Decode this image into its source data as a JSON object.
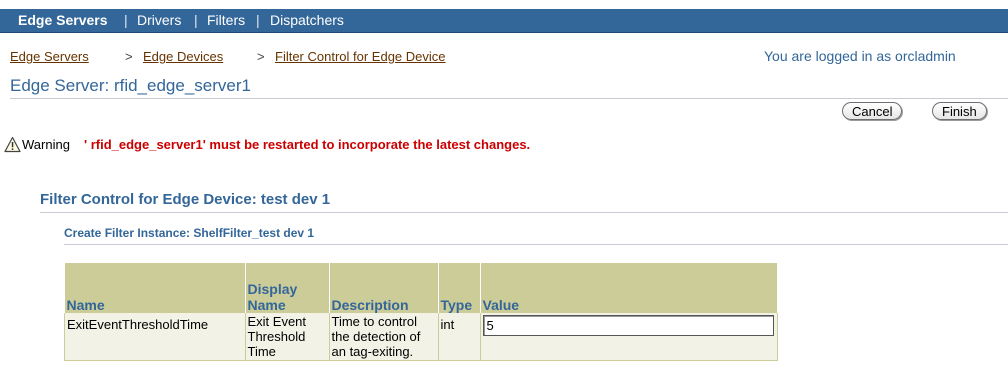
{
  "topnav": {
    "items": [
      "Edge Servers",
      "Drivers",
      "Filters",
      "Dispatchers"
    ],
    "separator": "|"
  },
  "breadcrumb": {
    "items": [
      "Edge Servers",
      "Edge Devices",
      "Filter Control for Edge Device"
    ],
    "separator": ">"
  },
  "user": {
    "logged_in_text": "You are logged in as orcladmin"
  },
  "page": {
    "title": "Edge Server: rfid_edge_server1"
  },
  "buttons": {
    "cancel": "Cancel",
    "finish": "Finish"
  },
  "warning": {
    "label": "Warning",
    "message": "' rfid_edge_server1' must be restarted to incorporate the latest changes."
  },
  "section": {
    "title": "Filter Control for Edge Device: test dev 1",
    "subtitle": "Create Filter Instance: ShelfFilter_test dev 1"
  },
  "table": {
    "headers": [
      "Name",
      "Display Name",
      "Description",
      "Type",
      "Value"
    ],
    "rows": [
      {
        "name": "ExitEventThresholdTime",
        "display_name": "Exit Event Threshold Time",
        "description": "Time to control the detection of an tag-exiting.",
        "type": "int",
        "value": "5"
      }
    ]
  },
  "colors": {
    "nav_bg": "#336699",
    "header_bg": "#cccc99",
    "link_brown": "#663300",
    "warning_red": "#cc0000",
    "title_blue": "#336699"
  },
  "icons": {
    "warning": "warning-triangle-icon"
  }
}
